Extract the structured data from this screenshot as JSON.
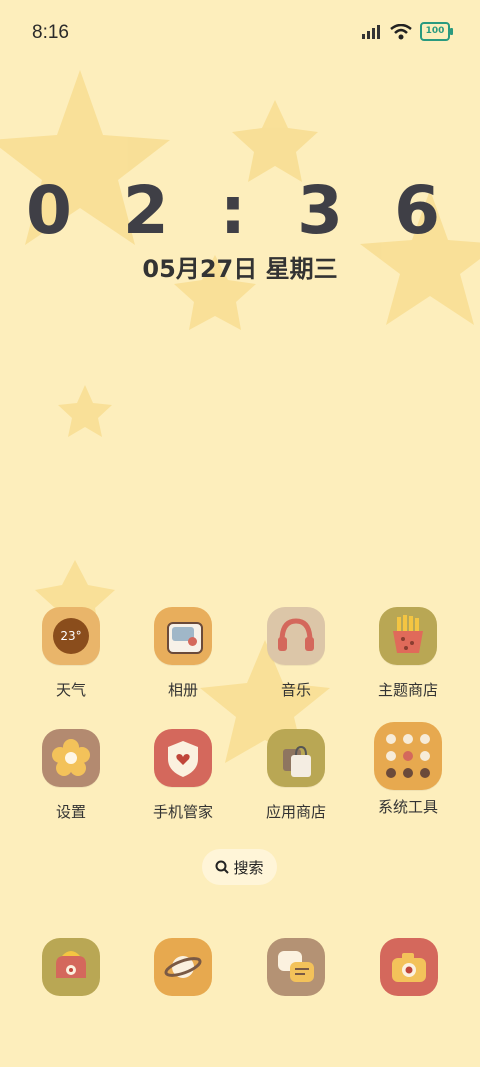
{
  "status": {
    "time": "8:16",
    "battery": "100"
  },
  "clock": {
    "time": "0 2 : 3 6",
    "date": "05月27日 星期三"
  },
  "apps_row1": [
    {
      "label": "天气",
      "badge": "23°",
      "icon": "weather-icon",
      "color": "#e9b56a"
    },
    {
      "label": "相册",
      "icon": "gallery-icon",
      "color": "#e8ae5c"
    },
    {
      "label": "音乐",
      "icon": "headphones-icon",
      "color": "#dcc6a8"
    },
    {
      "label": "主题商店",
      "icon": "fries-icon",
      "color": "#b9a754"
    }
  ],
  "apps_row2": [
    {
      "label": "设置",
      "icon": "flower-icon",
      "color": "#b38a70"
    },
    {
      "label": "手机管家",
      "icon": "shield-heart-icon",
      "color": "#d4685c"
    },
    {
      "label": "应用商店",
      "icon": "shopping-bag-icon",
      "color": "#b9a754"
    },
    {
      "label": "系统工具",
      "icon": "tools-folder-icon",
      "color": "#e7a94f"
    }
  ],
  "search": {
    "label": "搜索"
  },
  "dock": [
    {
      "icon": "phone-icon",
      "color": "#b9a754"
    },
    {
      "icon": "planet-icon",
      "color": "#e7a94f"
    },
    {
      "icon": "messages-icon",
      "color": "#b49274"
    },
    {
      "icon": "camera-icon",
      "color": "#d4685c"
    }
  ]
}
